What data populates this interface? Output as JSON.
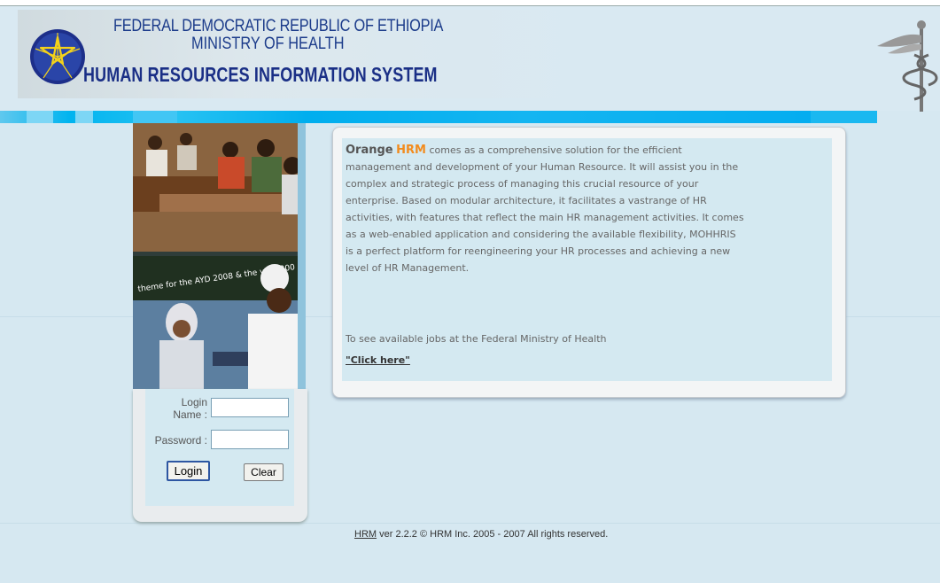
{
  "header": {
    "line1": "FEDERAL DEMOCRATIC REPUBLIC OF ETHIOPIA",
    "line2": "MINISTRY OF HEALTH",
    "line3": "HUMAN RESOURCES INFORMATION SYSTEM",
    "emblem_icon": "ethiopian-star-emblem-icon",
    "side_icon": "caduceus-icon"
  },
  "login": {
    "name_label": "Login Name :",
    "name_label_line1": "Login",
    "name_label_line2": "Name :",
    "password_label": "Password :",
    "name_value": "",
    "password_value": "",
    "login_button": "Login",
    "clear_button": "Clear"
  },
  "content": {
    "brand_part1": "Orange",
    "brand_part2": "HRM",
    "description": " comes as a comprehensive solution for the efficient management and development of your Human Resource. It will assist you in the complex and strategic process of managing this crucial resource of your enterprise. Based on modular architecture, it facilitates a vastrange of HR activities, with features that reflect the main HR management activities. It comes as a web-enabled application and considering the available flexibility, MOHHRIS is a perfect platform for reengineering your HR processes and achieving a new level of HR Management.",
    "jobs_text": "To see available jobs at the Federal Ministry of Health",
    "click_link": "\"Click here\""
  },
  "footer": {
    "link": "HRM",
    "text": " ver 2.2.2 © HRM Inc. 2005 - 2007 All rights reserved."
  },
  "colors": {
    "background": "#d6e8f1",
    "title_blue": "#1a2f86",
    "accent_cyan": "#00b4ef",
    "brand_orange": "#f28c1e"
  }
}
